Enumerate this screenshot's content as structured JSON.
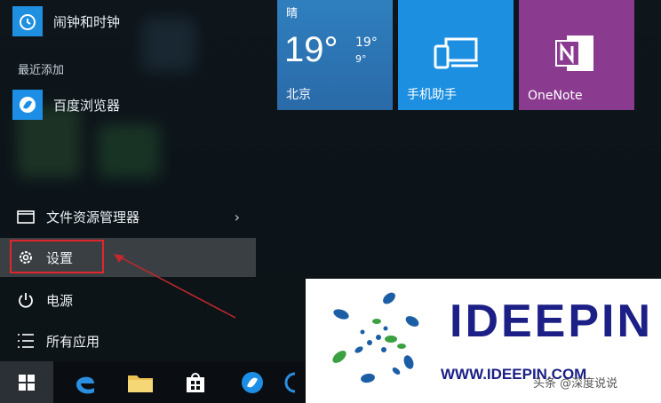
{
  "start_menu": {
    "pinned_app": {
      "label": "闹钟和时钟",
      "icon": "alarm-clock-icon"
    },
    "recent_section_label": "最近添加",
    "recent_app": {
      "label": "百度浏览器",
      "icon": "baidu-browser-icon"
    },
    "items": {
      "file_explorer": {
        "label": "文件资源管理器",
        "icon": "file-explorer-icon"
      },
      "settings": {
        "label": "设置",
        "icon": "gear-icon"
      },
      "power": {
        "label": "电源",
        "icon": "power-icon"
      },
      "all_apps": {
        "label": "所有应用",
        "icon": "list-icon"
      }
    }
  },
  "tiles": {
    "weather": {
      "condition": "晴",
      "temp": "19°",
      "high": "19°",
      "low": "9°",
      "city": "北京"
    },
    "phone": {
      "label": "手机助手"
    },
    "onenote": {
      "label": "OneNote"
    }
  },
  "taskbar": [
    "windows-start-icon",
    "edge-icon",
    "file-folder-icon",
    "store-icon",
    "baidu-browser-icon"
  ],
  "watermark": {
    "brand": "IDEEPIN",
    "url": "WWW.IDEEPIN.COM",
    "credit": "头条 @深度说说"
  },
  "colors": {
    "highlight_red": "#e0262c",
    "tile_blue": "#1c8fe1",
    "onenote_purple": "#8a3a8f"
  }
}
